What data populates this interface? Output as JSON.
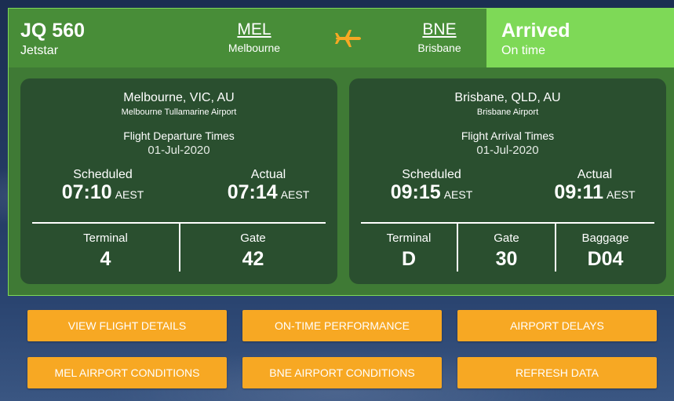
{
  "header": {
    "flight_number": "JQ 560",
    "airline": "Jetstar",
    "origin_code": "MEL",
    "origin_city": "Melbourne",
    "destination_code": "BNE",
    "destination_city": "Brisbane",
    "icon": "airplane-icon",
    "status": "Arrived",
    "status_detail": "On time"
  },
  "departure": {
    "location": "Melbourne, VIC, AU",
    "airport": "Melbourne Tullamarine Airport",
    "times_label": "Flight Departure Times",
    "date": "01-Jul-2020",
    "scheduled_label": "Scheduled",
    "scheduled_time": "07:10",
    "scheduled_tz": "AEST",
    "actual_label": "Actual",
    "actual_time": "07:14",
    "actual_tz": "AEST",
    "terminal_label": "Terminal",
    "terminal": "4",
    "gate_label": "Gate",
    "gate": "42"
  },
  "arrival": {
    "location": "Brisbane, QLD, AU",
    "airport": "Brisbane Airport",
    "times_label": "Flight Arrival Times",
    "date": "01-Jul-2020",
    "scheduled_label": "Scheduled",
    "scheduled_time": "09:15",
    "scheduled_tz": "AEST",
    "actual_label": "Actual",
    "actual_time": "09:11",
    "actual_tz": "AEST",
    "terminal_label": "Terminal",
    "terminal": "D",
    "gate_label": "Gate",
    "gate": "30",
    "baggage_label": "Baggage",
    "baggage": "D04"
  },
  "buttons": {
    "view_flight_details": "VIEW FLIGHT DETAILS",
    "on_time_performance": "ON-TIME PERFORMANCE",
    "airport_delays": "AIRPORT DELAYS",
    "mel_airport_conditions": "MEL AIRPORT CONDITIONS",
    "bne_airport_conditions": "BNE AIRPORT CONDITIONS",
    "refresh_data": "REFRESH DATA"
  },
  "colors": {
    "header_green": "#488d38",
    "status_green": "#7ed957",
    "panel_dark_green": "#2a4f2f",
    "button_orange": "#f7a823",
    "plane_orange": "#f7a823"
  }
}
